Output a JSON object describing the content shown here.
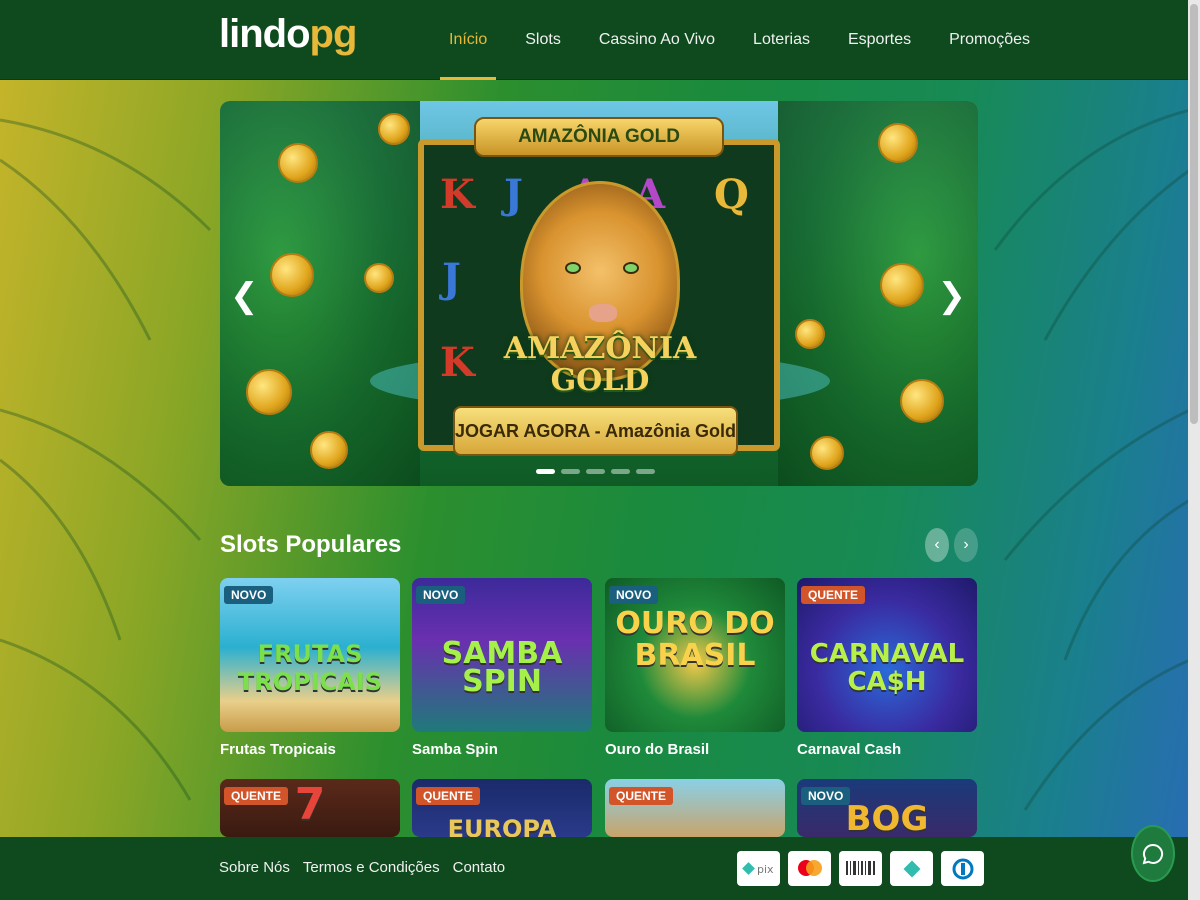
{
  "logo": {
    "part1": "lindo",
    "part2": "pg"
  },
  "nav": [
    {
      "label": "Início",
      "active": true
    },
    {
      "label": "Slots"
    },
    {
      "label": "Cassino Ao Vivo"
    },
    {
      "label": "Loterias"
    },
    {
      "label": "Esportes"
    },
    {
      "label": "Promoções"
    }
  ],
  "hero": {
    "machine_title": "AMAZÔNIA GOLD",
    "game_title_1": "AMAZÔNIA",
    "game_title_2": "GOLD",
    "cta_label": "JOGAR AGORA - Amazônia Gold",
    "reel_symbols": [
      "K",
      "J",
      "A",
      "A",
      "Q",
      "J",
      "K"
    ],
    "slides_total": 5,
    "slide_active": 1
  },
  "section": {
    "title": "Slots Populares"
  },
  "cards": [
    {
      "name": "Frutas Tropicais",
      "badge": "NOVO",
      "art": "FRUTAS TROPICAIS"
    },
    {
      "name": "Samba Spin",
      "badge": "NOVO",
      "art": "SAMBA SPIN"
    },
    {
      "name": "Ouro do Brasil",
      "badge": "NOVO",
      "art": "OURO DO BRASIL"
    },
    {
      "name": "Carnaval Cash",
      "badge": "QUENTE",
      "art": "CARNAVAL CA$H"
    },
    {
      "badge": "QUENTE",
      "art": "7"
    },
    {
      "badge": "QUENTE",
      "art": "EUROPA"
    },
    {
      "badge": "QUENTE",
      "art": ""
    },
    {
      "badge": "NOVO",
      "art": "BOG"
    }
  ],
  "footer": {
    "links": [
      "Sobre Nós",
      "Termos e Condições",
      "Contato"
    ],
    "payments": [
      "pix",
      "mastercard",
      "boleto",
      "pix-diamond",
      "diners"
    ]
  },
  "colors": {
    "header": "#0f4a1f",
    "accent": "#e8b83a",
    "badge_novo": "#1b5f7e",
    "badge_quente": "#d2552a"
  }
}
